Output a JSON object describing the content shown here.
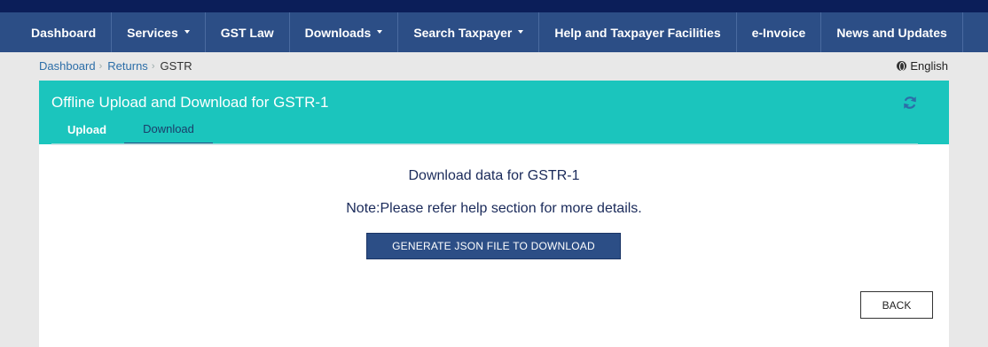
{
  "nav": {
    "items": [
      {
        "label": "Dashboard",
        "dropdown": false
      },
      {
        "label": "Services",
        "dropdown": true
      },
      {
        "label": "GST Law",
        "dropdown": false
      },
      {
        "label": "Downloads",
        "dropdown": true
      },
      {
        "label": "Search Taxpayer",
        "dropdown": true
      },
      {
        "label": "Help and Taxpayer Facilities",
        "dropdown": false
      },
      {
        "label": "e-Invoice",
        "dropdown": false
      },
      {
        "label": "News and Updates",
        "dropdown": false
      }
    ]
  },
  "breadcrumb": {
    "items": [
      "Dashboard",
      "Returns"
    ],
    "current": "GSTR"
  },
  "language": {
    "label": "English",
    "icon": "globe-icon"
  },
  "panel": {
    "title": "Offline Upload and Download for GSTR-1",
    "refresh_icon": "refresh-icon",
    "tabs": [
      "Upload",
      "Download"
    ],
    "active_tab": "Download"
  },
  "content": {
    "heading": "Download data for GSTR-1",
    "note": "Note:Please refer help section for more details.",
    "generate_label": "GENERATE JSON FILE TO DOWNLOAD",
    "back_label": "BACK"
  },
  "colors": {
    "nav_bg": "#2c4e86",
    "top_strip": "#0b1e59",
    "panel_bg": "#1bc5bd",
    "refresh_icon": "#2c6ea8"
  }
}
